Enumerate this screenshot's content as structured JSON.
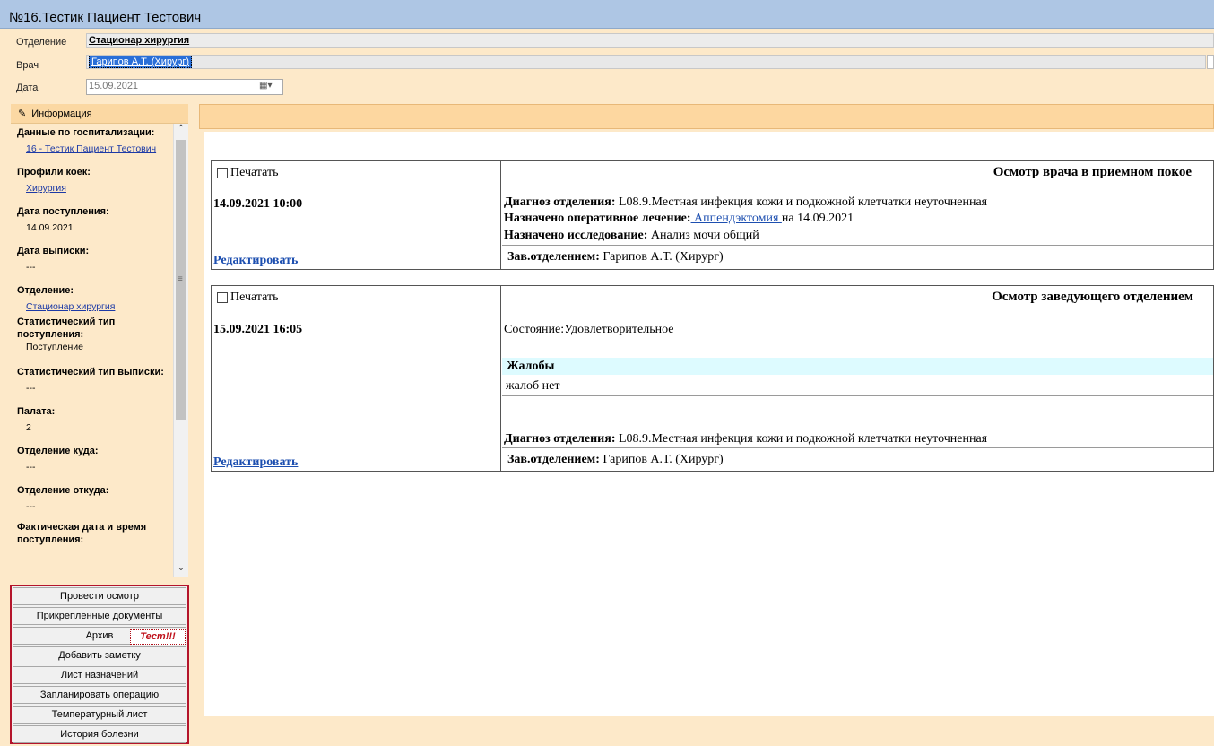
{
  "window": {
    "title": "№16.Тестик Пациент Тестович"
  },
  "header": {
    "department_label": "Отделение",
    "department_value": "Стационар хирургия",
    "doctor_label": "Врач",
    "doctor_value": "Гарипов А.Т. (Хирург)",
    "date_label": "Дата",
    "date_value": "15.09.2021"
  },
  "sidebar": {
    "header": "Информация",
    "items": [
      {
        "label": "Данные по госпитализации:",
        "value": "16 - Тестик Пациент Тестович",
        "link": true
      },
      {
        "label": "Профили коек:",
        "value": "Хирургия",
        "link": true
      },
      {
        "label": "Дата поступления:",
        "value": "14.09.2021",
        "link": false
      },
      {
        "label": "Дата выписки:",
        "value": "---",
        "link": false
      },
      {
        "label": "Отделение:",
        "value": "Стационар хирургия",
        "link": true
      },
      {
        "label": "Статистический тип поступления:",
        "value": "Поступление",
        "link": false
      },
      {
        "label": "Статистический тип выписки:",
        "value": "---",
        "link": false
      },
      {
        "label": "Палата:",
        "value": "2",
        "link": false
      },
      {
        "label": "Отделение куда:",
        "value": "---",
        "link": false
      },
      {
        "label": "Отделение откуда:",
        "value": "---",
        "link": false
      },
      {
        "label": "Фактическая дата и время поступления:",
        "value": "",
        "link": false
      }
    ]
  },
  "buttons": [
    "Провести осмотр",
    "Прикрепленные документы",
    "Архив",
    "Добавить заметку",
    "Лист назначений",
    "Запланировать операцию",
    "Температурный лист",
    "История болезни"
  ],
  "test_label": "Тест!!!",
  "records": [
    {
      "print_label": "Печатать",
      "datetime": "14.09.2021 10:00",
      "title": "Осмотр врача в приемном покое",
      "diag_label": "Диагноз отделения:",
      "diag_value": " L08.9.Местная инфекция кожи и подкожной клетчатки неуточненная",
      "oper_label": "Назначено оперативное лечение:",
      "oper_link": " Аппендэктомия ",
      "oper_suffix": "на 14.09.2021",
      "exam_label": "Назначено исследование:",
      "exam_value": " Анализ мочи общий",
      "edit_label": "Редактировать",
      "head_label": "Зав.отделением:",
      "head_value": " Гарипов А.Т. (Хирург)"
    },
    {
      "print_label": "Печатать",
      "datetime": "15.09.2021 16:05",
      "title": "Осмотр заведующего отделением",
      "state": "Состояние:Удовлетворительное",
      "complaints_label": "Жалобы",
      "complaints_value": "жалоб нет",
      "diag_label": "Диагноз отделения:",
      "diag_value": " L08.9.Местная инфекция кожи и подкожной клетчатки неуточненная",
      "edit_label": "Редактировать",
      "head_label": "Зав.отделением:",
      "head_value": " Гарипов А.Т. (Хирург)"
    }
  ]
}
